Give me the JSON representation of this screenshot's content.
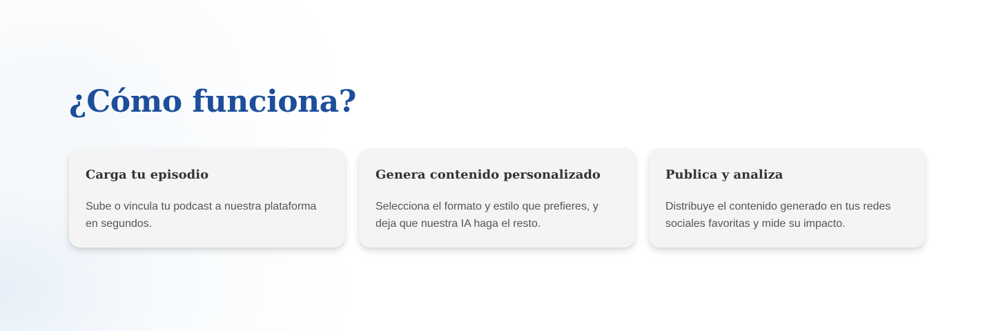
{
  "colors": {
    "heading": "#1d4e9a",
    "card_background": "#f4f4f4",
    "card_title": "#333333",
    "card_text": "#555555"
  },
  "section": {
    "title": "¿Cómo funciona?"
  },
  "steps": [
    {
      "title": "Carga tu episodio",
      "description": "Sube o vincula tu podcast a nuestra plataforma en segundos."
    },
    {
      "title": "Genera contenido personalizado",
      "description": "Selecciona el formato y estilo que prefieres, y deja que nuestra IA haga el resto."
    },
    {
      "title": "Publica y analiza",
      "description": "Distribuye el contenido generado en tus redes sociales favoritas y mide su impacto."
    }
  ]
}
